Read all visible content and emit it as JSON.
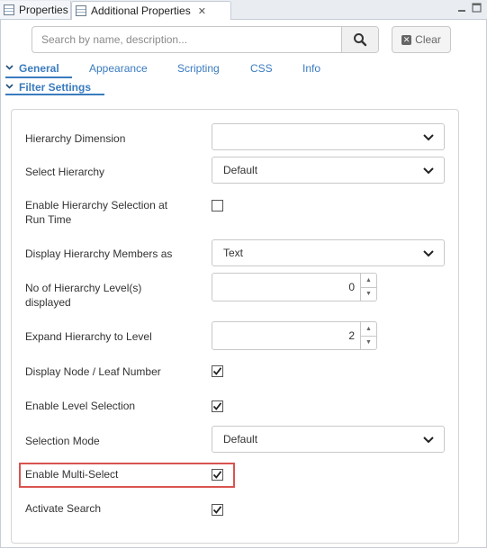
{
  "tabs": [
    {
      "label": "Properties"
    },
    {
      "label": "Additional Properties"
    }
  ],
  "search": {
    "placeholder": "Search by name, description...",
    "value": ""
  },
  "clear_label": "Clear",
  "nav": {
    "items": [
      "General",
      "Appearance",
      "Scripting",
      "CSS",
      "Info"
    ],
    "section": "Filter Settings"
  },
  "fields": {
    "hierarchy_dimension": {
      "label": "Hierarchy Dimension",
      "value": ""
    },
    "select_hierarchy": {
      "label": "Select Hierarchy",
      "value": "Default"
    },
    "enable_hierarchy_selection": {
      "label_line1": "Enable Hierarchy Selection at",
      "label_line2": "Run Time",
      "checked": false
    },
    "display_members_as": {
      "label": "Display Hierarchy Members as",
      "value": "Text"
    },
    "levels_displayed": {
      "label_line1": "No of Hierarchy Level(s)",
      "label_line2": "displayed",
      "value": "0"
    },
    "expand_to_level": {
      "label": "Expand Hierarchy to Level",
      "value": "2"
    },
    "display_node_leaf": {
      "label": "Display Node / Leaf Number",
      "checked": true
    },
    "enable_level_selection": {
      "label": "Enable Level Selection",
      "checked": true
    },
    "selection_mode": {
      "label": "Selection Mode",
      "value": "Default"
    },
    "enable_multi_select": {
      "label": "Enable Multi-Select",
      "checked": true
    },
    "activate_search": {
      "label": "Activate Search",
      "checked": true
    }
  },
  "colors": {
    "accent": "#3a7bbf",
    "highlight": "#d9534f"
  }
}
